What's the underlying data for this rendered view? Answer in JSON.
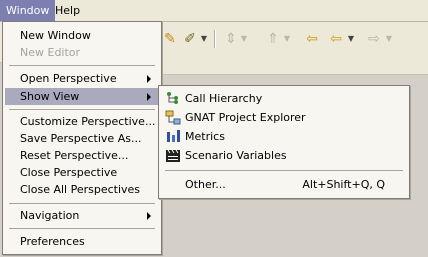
{
  "menubar": {
    "window": "Window",
    "help": "Help"
  },
  "toolbar": {
    "icons": [
      "pencil-icon",
      "wand-icon",
      "navigate-icon",
      "jump-icon",
      "previous-edit-icon",
      "back-icon",
      "forward-icon"
    ]
  },
  "window_menu": {
    "new_window": "New Window",
    "new_editor": "New Editor",
    "open_perspective": "Open Perspective",
    "show_view": "Show View",
    "customize_perspective": "Customize Perspective...",
    "save_perspective_as": "Save Perspective As...",
    "reset_perspective": "Reset Perspective...",
    "close_perspective": "Close Perspective",
    "close_all_perspectives": "Close All Perspectives",
    "navigation": "Navigation",
    "preferences": "Preferences"
  },
  "show_view_menu": {
    "call_hierarchy": "Call Hierarchy",
    "gnat_project_explorer": "GNAT Project Explorer",
    "metrics": "Metrics",
    "scenario_variables": "Scenario Variables",
    "other": "Other...",
    "other_shortcut": "Alt+Shift+Q, Q"
  }
}
